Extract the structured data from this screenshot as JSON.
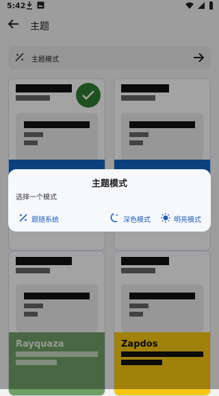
{
  "statusbar": {
    "time": "5:42",
    "left_icons": [
      "download-icon",
      "image-icon"
    ],
    "right_icons": [
      "wifi-icon",
      "signal-icon",
      "battery-icon"
    ]
  },
  "appbar": {
    "title": "主题"
  },
  "mode_row": {
    "label": "主题模式"
  },
  "cards": [
    {
      "name": "",
      "selected": true,
      "band_color": "#1565c0",
      "band_name": ""
    },
    {
      "name": "",
      "selected": false,
      "band_color": "#1565c0",
      "band_name": ""
    },
    {
      "name": "Rayquaza",
      "selected": false,
      "band_color": "#6f9f66",
      "band_name": "Rayquaza"
    },
    {
      "name": "Zapdos",
      "selected": false,
      "band_color": "#f6c613",
      "band_name": "Zapdos"
    }
  ],
  "dialog": {
    "title": "主题模式",
    "subtitle": "选择一个模式",
    "buttons": [
      {
        "label": "跟随系统",
        "icon": "auto-mode-icon"
      },
      {
        "label": "深色模式",
        "icon": "dark-mode-icon"
      },
      {
        "label": "明亮模式",
        "icon": "light-mode-icon"
      }
    ]
  },
  "colors": {
    "accent": "#1e5db6",
    "selected_check": "#2e7d32"
  }
}
